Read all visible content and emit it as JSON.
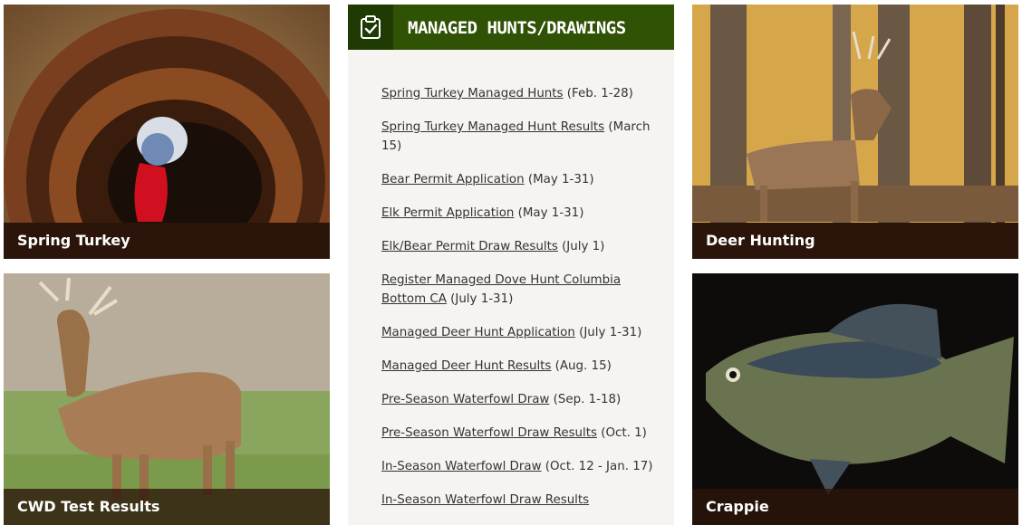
{
  "tiles": {
    "turkey": {
      "label": "Spring Turkey"
    },
    "cwd": {
      "label": "CWD Test Results"
    },
    "deer": {
      "label": "Deer Hunting"
    },
    "crappie": {
      "label": "Crappie"
    }
  },
  "panel": {
    "title": "MANAGED HUNTS/DRAWINGS",
    "icon": "clipboard-check-icon",
    "items": [
      {
        "link": "Spring Turkey Managed Hunts",
        "date": " (Feb. 1-28)"
      },
      {
        "link": "Spring Turkey Managed Hunt Results",
        "date": " (March 15)"
      },
      {
        "link": "Bear Permit Application",
        "date": " (May 1-31)"
      },
      {
        "link": "Elk Permit Application",
        "date": " (May 1-31)"
      },
      {
        "link": "Elk/Bear Permit Draw Results",
        "date": " (July 1)"
      },
      {
        "link": "Register Managed Dove Hunt Columbia Bottom CA",
        "date": " (July 1-31)"
      },
      {
        "link": "Managed Deer Hunt Application",
        "date": " (July 1-31)"
      },
      {
        "link": "Managed Deer Hunt Results",
        "date": " (Aug. 15)"
      },
      {
        "link": "Pre-Season Waterfowl Draw",
        "date": " (Sep. 1-18)"
      },
      {
        "link": "Pre-Season Waterfowl Draw Results",
        "date": " (Oct. 1)"
      },
      {
        "link": "In-Season Waterfowl Draw",
        "date": " (Oct. 12 - Jan. 17)"
      },
      {
        "link": "In-Season Waterfowl Draw Results",
        "date": ""
      }
    ]
  },
  "colors": {
    "header_green": "#2f5205",
    "icon_box": "#1f3a03",
    "panel_bg": "#f5f4f1",
    "caption_bg": "#2c160a"
  }
}
